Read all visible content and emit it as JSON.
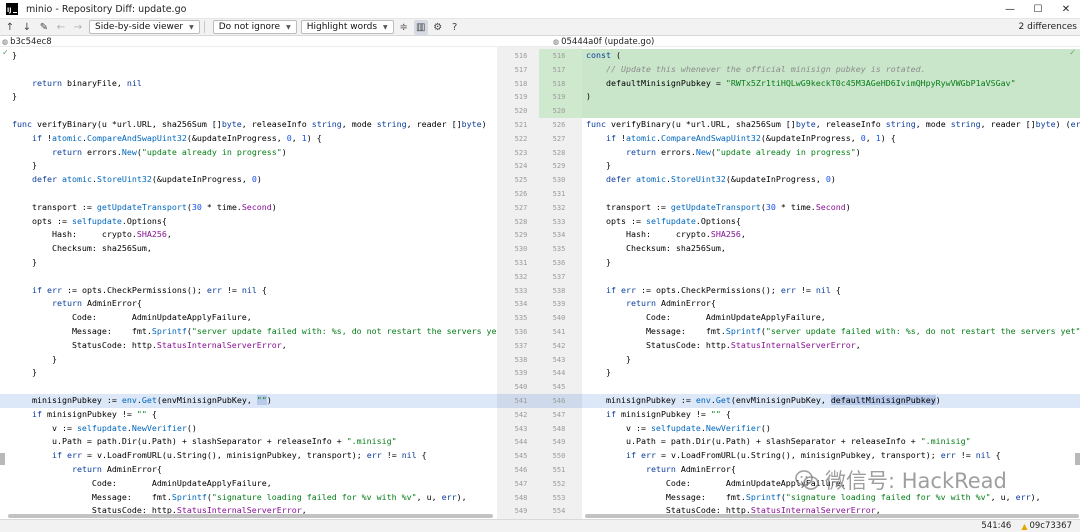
{
  "window": {
    "title": "minio - Repository Diff: update.go",
    "app_icon_label": "IJ",
    "controls": [
      "—",
      "☐",
      "✕"
    ]
  },
  "toolbar": {
    "viewer": "Side-by-side viewer",
    "ignore": "Do not ignore",
    "highlight": "Highlight words",
    "help": "?",
    "differences": "2 differences"
  },
  "revisions": {
    "left": "b3c54ec8",
    "right": "05444a0f (update.go)"
  },
  "status": {
    "position": "541:46",
    "revision": "09c73367"
  },
  "watermark": {
    "text": "微信号: HackRead"
  },
  "diff": {
    "left_lines": [
      {
        "n": "",
        "ltype": "plain",
        "code": "}"
      },
      {
        "n": "",
        "ltype": "plain",
        "code": ""
      },
      {
        "n": "",
        "ltype": "plain",
        "code": "    return binaryFile, nil"
      },
      {
        "n": "",
        "ltype": "plain",
        "code": "}"
      },
      {
        "n": "",
        "ltype": "plain",
        "code": ""
      },
      {
        "n": "521",
        "ltype": "plain",
        "code": "func verifyBinary(u *url.URL, sha256Sum []byte, releaseInfo string, mode string, reader []byte)"
      },
      {
        "n": "522",
        "ltype": "plain",
        "code": "    if !atomic.CompareAndSwapUint32(&updateInProgress, 0, 1) {"
      },
      {
        "n": "523",
        "ltype": "plain",
        "code": "        return errors.New(\"update already in progress\")"
      },
      {
        "n": "524",
        "ltype": "plain",
        "code": "    }"
      },
      {
        "n": "525",
        "ltype": "plain",
        "code": "    defer atomic.StoreUint32(&updateInProgress, 0)"
      },
      {
        "n": "526",
        "ltype": "plain",
        "code": ""
      },
      {
        "n": "527",
        "ltype": "plain",
        "code": "    transport := getUpdateTransport(30 * time.Second)"
      },
      {
        "n": "528",
        "ltype": "plain",
        "code": "    opts := selfupdate.Options{"
      },
      {
        "n": "529",
        "ltype": "plain",
        "code": "        Hash:     crypto.SHA256,"
      },
      {
        "n": "530",
        "ltype": "plain",
        "code": "        Checksum: sha256Sum,"
      },
      {
        "n": "531",
        "ltype": "plain",
        "code": "    }"
      },
      {
        "n": "532",
        "ltype": "plain",
        "code": ""
      },
      {
        "n": "533",
        "ltype": "plain",
        "code": "    if err := opts.CheckPermissions(); err != nil {"
      },
      {
        "n": "534",
        "ltype": "plain",
        "code": "        return AdminError{"
      },
      {
        "n": "535",
        "ltype": "plain",
        "code": "            Code:       AdminUpdateApplyFailure,"
      },
      {
        "n": "536",
        "ltype": "plain",
        "code": "            Message:    fmt.Sprintf(\"server update failed with: %s, do not restart the servers yet\", err),"
      },
      {
        "n": "537",
        "ltype": "plain",
        "code": "            StatusCode: http.StatusInternalServerError,"
      },
      {
        "n": "538",
        "ltype": "plain",
        "code": "        }"
      },
      {
        "n": "539",
        "ltype": "plain",
        "code": "    }"
      },
      {
        "n": "540",
        "ltype": "plain",
        "code": ""
      },
      {
        "n": "541",
        "ltype": "hl",
        "code": "    minisignPubkey := env.Get(envMinisignPubKey, \"\")",
        "word": "\"\""
      },
      {
        "n": "542",
        "ltype": "plain",
        "code": "    if minisignPubkey != \"\" {"
      },
      {
        "n": "543",
        "ltype": "plain",
        "code": "        v := selfupdate.NewVerifier()"
      },
      {
        "n": "544",
        "ltype": "plain",
        "code": "        u.Path = path.Dir(u.Path) + slashSeparator + releaseInfo + \".minisig\""
      },
      {
        "n": "545",
        "ltype": "plain",
        "code": "        if err = v.LoadFromURL(u.String(), minisignPubkey, transport); err != nil {"
      },
      {
        "n": "546",
        "ltype": "plain",
        "code": "            return AdminError{"
      },
      {
        "n": "547",
        "ltype": "plain",
        "code": "                Code:       AdminUpdateApplyFailure,"
      },
      {
        "n": "548",
        "ltype": "plain",
        "code": "                Message:    fmt.Sprintf(\"signature loading failed for %v with %v\", u, err),"
      },
      {
        "n": "549",
        "ltype": "plain",
        "code": "                StatusCode: http.StatusInternalServerError,"
      },
      {
        "n": "550",
        "ltype": "plain",
        "code": "            }"
      }
    ],
    "right_lines": [
      {
        "n": "516",
        "ltype": "added",
        "code": "const ("
      },
      {
        "n": "517",
        "ltype": "added",
        "code": "    // Update this whenever the official minisign pubkey is rotated."
      },
      {
        "n": "518",
        "ltype": "added",
        "code": "    defaultMinisignPubkey = \"RWTx5Zr1tiHQLwG9keckT0c45M3AGeHD6IvimQHpyRywVWGbP1aVSGav\""
      },
      {
        "n": "519",
        "ltype": "added",
        "code": ")"
      },
      {
        "n": "520",
        "ltype": "added",
        "code": ""
      },
      {
        "n": "526",
        "ltype": "plain",
        "code": "func verifyBinary(u *url.URL, sha256Sum []byte, releaseInfo string, mode string, reader []byte) (err"
      },
      {
        "n": "527",
        "ltype": "plain",
        "code": "    if !atomic.CompareAndSwapUint32(&updateInProgress, 0, 1) {"
      },
      {
        "n": "528",
        "ltype": "plain",
        "code": "        return errors.New(\"update already in progress\")"
      },
      {
        "n": "529",
        "ltype": "plain",
        "code": "    }"
      },
      {
        "n": "530",
        "ltype": "plain",
        "code": "    defer atomic.StoreUint32(&updateInProgress, 0)"
      },
      {
        "n": "531",
        "ltype": "plain",
        "code": ""
      },
      {
        "n": "532",
        "ltype": "plain",
        "code": "    transport := getUpdateTransport(30 * time.Second)"
      },
      {
        "n": "533",
        "ltype": "plain",
        "code": "    opts := selfupdate.Options{"
      },
      {
        "n": "534",
        "ltype": "plain",
        "code": "        Hash:     crypto.SHA256,"
      },
      {
        "n": "535",
        "ltype": "plain",
        "code": "        Checksum: sha256Sum,"
      },
      {
        "n": "536",
        "ltype": "plain",
        "code": "    }"
      },
      {
        "n": "537",
        "ltype": "plain",
        "code": ""
      },
      {
        "n": "538",
        "ltype": "plain",
        "code": "    if err := opts.CheckPermissions(); err != nil {"
      },
      {
        "n": "539",
        "ltype": "plain",
        "code": "        return AdminError{"
      },
      {
        "n": "540",
        "ltype": "plain",
        "code": "            Code:       AdminUpdateApplyFailure,"
      },
      {
        "n": "541",
        "ltype": "plain",
        "code": "            Message:    fmt.Sprintf(\"server update failed with: %s, do not restart the servers yet\", err),"
      },
      {
        "n": "542",
        "ltype": "plain",
        "code": "            StatusCode: http.StatusInternalServerError,"
      },
      {
        "n": "543",
        "ltype": "plain",
        "code": "        }"
      },
      {
        "n": "544",
        "ltype": "plain",
        "code": "    }"
      },
      {
        "n": "545",
        "ltype": "plain",
        "code": ""
      },
      {
        "n": "546",
        "ltype": "hl",
        "code": "    minisignPubkey := env.Get(envMinisignPubKey, defaultMinisignPubkey)",
        "word": "defaultMinisignPubkey"
      },
      {
        "n": "547",
        "ltype": "plain",
        "code": "    if minisignPubkey != \"\" {"
      },
      {
        "n": "548",
        "ltype": "plain",
        "code": "        v := selfupdate.NewVerifier()"
      },
      {
        "n": "549",
        "ltype": "plain",
        "code": "        u.Path = path.Dir(u.Path) + slashSeparator + releaseInfo + \".minisig\""
      },
      {
        "n": "550",
        "ltype": "plain",
        "code": "        if err = v.LoadFromURL(u.String(), minisignPubkey, transport); err != nil {"
      },
      {
        "n": "551",
        "ltype": "plain",
        "code": "            return AdminError{"
      },
      {
        "n": "552",
        "ltype": "plain",
        "code": "                Code:       AdminUpdateApplyFailure,"
      },
      {
        "n": "553",
        "ltype": "plain",
        "code": "                Message:    fmt.Sprintf(\"signature loading failed for %v with %v\", u, err),"
      },
      {
        "n": "554",
        "ltype": "plain",
        "code": "                StatusCode: http.StatusInternalServerError,"
      },
      {
        "n": "555",
        "ltype": "plain",
        "code": "            }"
      }
    ],
    "left_gutter": [
      "516",
      "517",
      "518",
      "519",
      "520",
      "521",
      "522",
      "523",
      "524",
      "525",
      "526",
      "527",
      "528",
      "529",
      "530",
      "531",
      "532",
      "533",
      "534",
      "535",
      "536",
      "537",
      "538",
      "539",
      "540",
      "541",
      "542",
      "543",
      "544",
      "545",
      "546",
      "547",
      "548",
      "549",
      "550"
    ]
  }
}
